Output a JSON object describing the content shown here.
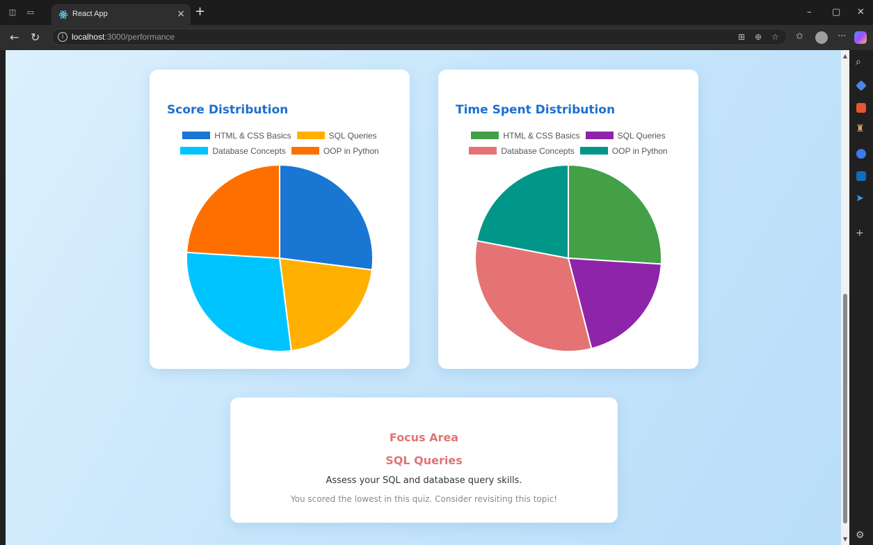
{
  "browser": {
    "tab_title": "React App",
    "tab_close": "×",
    "new_tab": "+",
    "url_host": "localhost",
    "url_path": ":3000/performance",
    "controls": {
      "minimize": "–",
      "restore": "▢",
      "close": "✕"
    }
  },
  "charts": {
    "score": {
      "title": "Score Distribution"
    },
    "time": {
      "title": "Time Spent Distribution"
    }
  },
  "chart_data": [
    {
      "type": "pie",
      "title": "Score Distribution",
      "categories": [
        "HTML & CSS Basics",
        "SQL Queries",
        "Database Concepts",
        "OOP in Python"
      ],
      "values": [
        27,
        21,
        28,
        24
      ],
      "colors": [
        "#1976d2",
        "#ffb000",
        "#00c4ff",
        "#ff6f00"
      ],
      "legend": "top"
    },
    {
      "type": "pie",
      "title": "Time Spent Distribution",
      "categories": [
        "HTML & CSS Basics",
        "SQL Queries",
        "Database Concepts",
        "OOP in Python"
      ],
      "values": [
        26,
        20,
        32,
        22
      ],
      "colors": [
        "#43a047",
        "#8e24aa",
        "#e57373",
        "#009688"
      ],
      "legend": "top"
    }
  ],
  "focus": {
    "title": "Focus Area",
    "topic": "SQL Queries",
    "description": "Assess your SQL and database query skills.",
    "note": "You scored the lowest in this quiz. Consider revisiting this topic!"
  },
  "sidebar_icons": [
    "search-icon",
    "tag-icon",
    "briefcase-icon",
    "chess-icon",
    "copilot-icon",
    "outlook-icon",
    "send-icon",
    "add-icon",
    "settings-icon"
  ]
}
